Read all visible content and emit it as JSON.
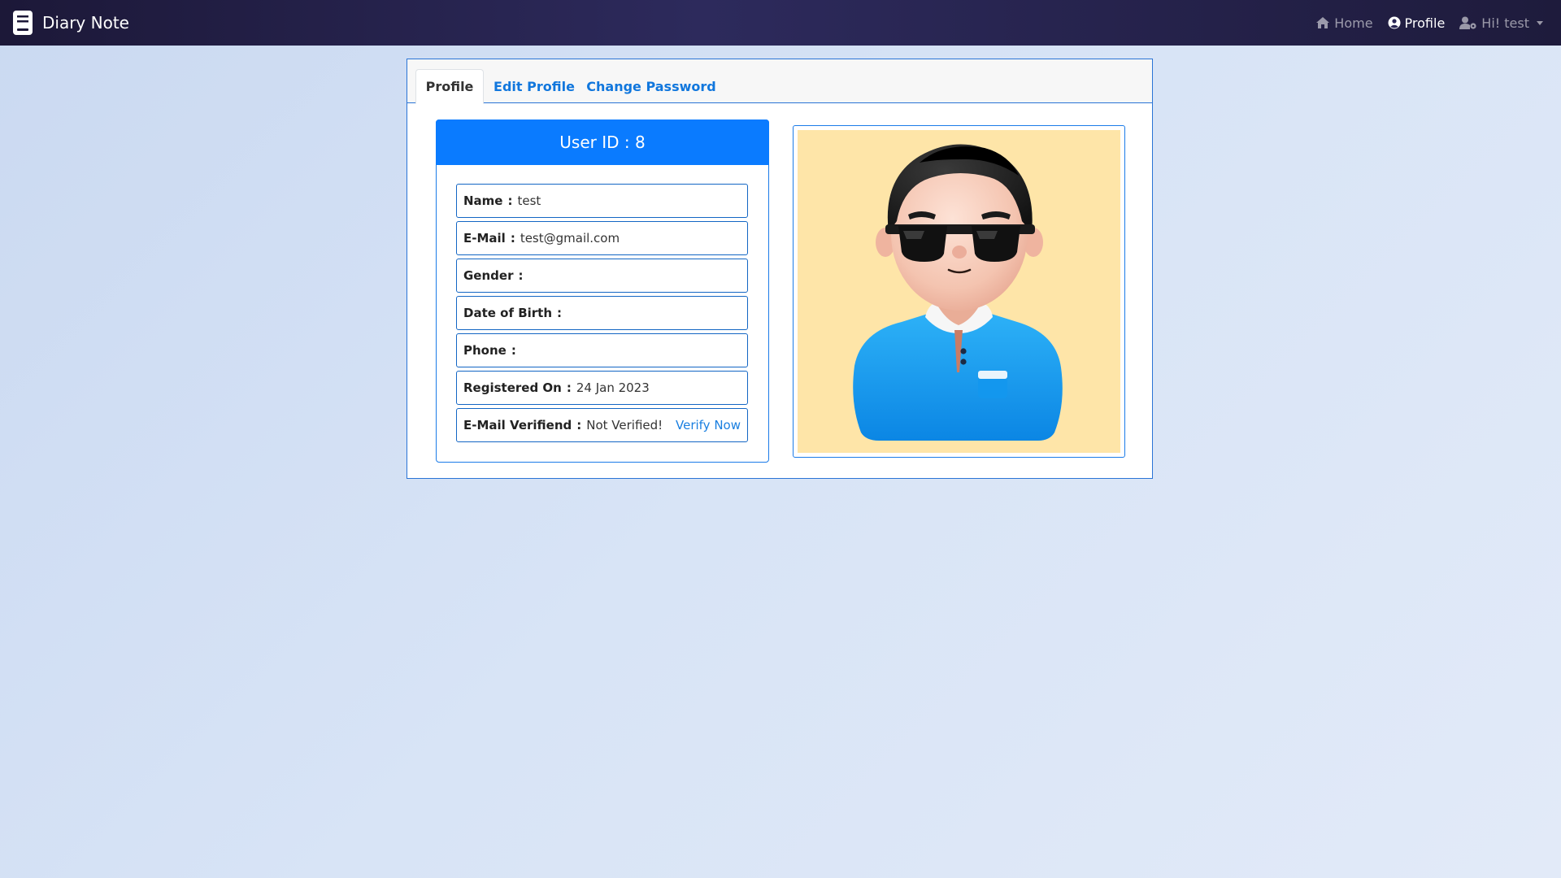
{
  "navbar": {
    "brand": "Diary Note",
    "links": [
      {
        "label": "Home",
        "icon": "home-icon"
      },
      {
        "label": "Profile",
        "icon": "user-circle-icon",
        "active": true
      },
      {
        "label": "Hi! test",
        "icon": "user-gear-icon",
        "dropdown": true
      }
    ]
  },
  "tabs": [
    {
      "label": "Profile",
      "active": true
    },
    {
      "label": "Edit Profile"
    },
    {
      "label": "Change Password"
    }
  ],
  "info": {
    "header": "User ID : 8",
    "rows": [
      {
        "label": "Name",
        "value": "test"
      },
      {
        "label": "E-Mail",
        "value": "test@gmail.com"
      },
      {
        "label": "Gender",
        "value": ""
      },
      {
        "label": "Date of Birth",
        "value": ""
      },
      {
        "label": "Phone",
        "value": ""
      },
      {
        "label": "Registered On",
        "value": "24 Jan 2023"
      },
      {
        "label": "E-Mail Verifiend",
        "value": "Not Verified!",
        "action": "Verify Now"
      }
    ]
  },
  "colors": {
    "primary": "#0a7bff",
    "link": "#1a7fe0",
    "navbar": "#1c1838",
    "avatar_bg": "#fee5a8",
    "shirt": "#1a9ff0"
  }
}
